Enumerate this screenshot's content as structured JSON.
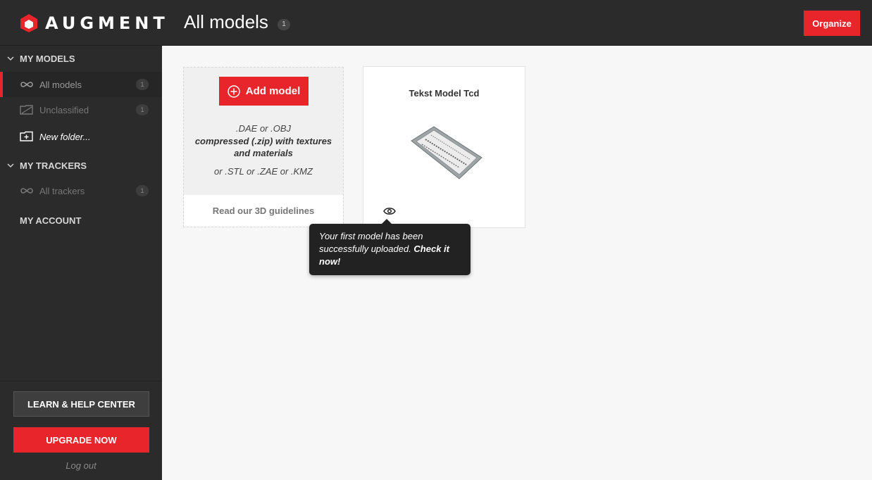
{
  "header": {
    "logo_text": "AUGMENT",
    "title": "All models",
    "title_count": "1",
    "organize_label": "Organize"
  },
  "sidebar": {
    "my_models_heading": "MY MODELS",
    "models_items": [
      {
        "label": "All models",
        "count": "1",
        "icon": "infinity-icon"
      },
      {
        "label": "Unclassified",
        "count": "1",
        "icon": "unclassified-folder-icon"
      },
      {
        "label": "New folder...",
        "icon": "new-folder-icon"
      }
    ],
    "my_trackers_heading": "MY TRACKERS",
    "trackers_items": [
      {
        "label": "All trackers",
        "count": "1",
        "icon": "infinity-icon"
      }
    ],
    "my_account_heading": "MY ACCOUNT",
    "learn_label": "LEARN & HELP CENTER",
    "upgrade_label": "UPGRADE NOW",
    "logout_label": "Log out"
  },
  "add_card": {
    "button_label": "Add model",
    "fmt_line1": ".DAE or .OBJ",
    "fmt_line2": "compressed (.zip) with textures",
    "fmt_line3": "and materials",
    "fmt_line4": "or .STL or .ZAE or .KMZ",
    "guidelines_label": "Read our 3D guidelines"
  },
  "model_card": {
    "title": "Tekst Model Tcd"
  },
  "tooltip": {
    "text": "Your first model has been successfully uploaded. ",
    "cta": "Check it now!"
  },
  "colors": {
    "accent": "#e8252a",
    "topbar": "#2b2b2b",
    "sidebar": "#2b2b2b",
    "main_bg": "#f7f7f7"
  }
}
